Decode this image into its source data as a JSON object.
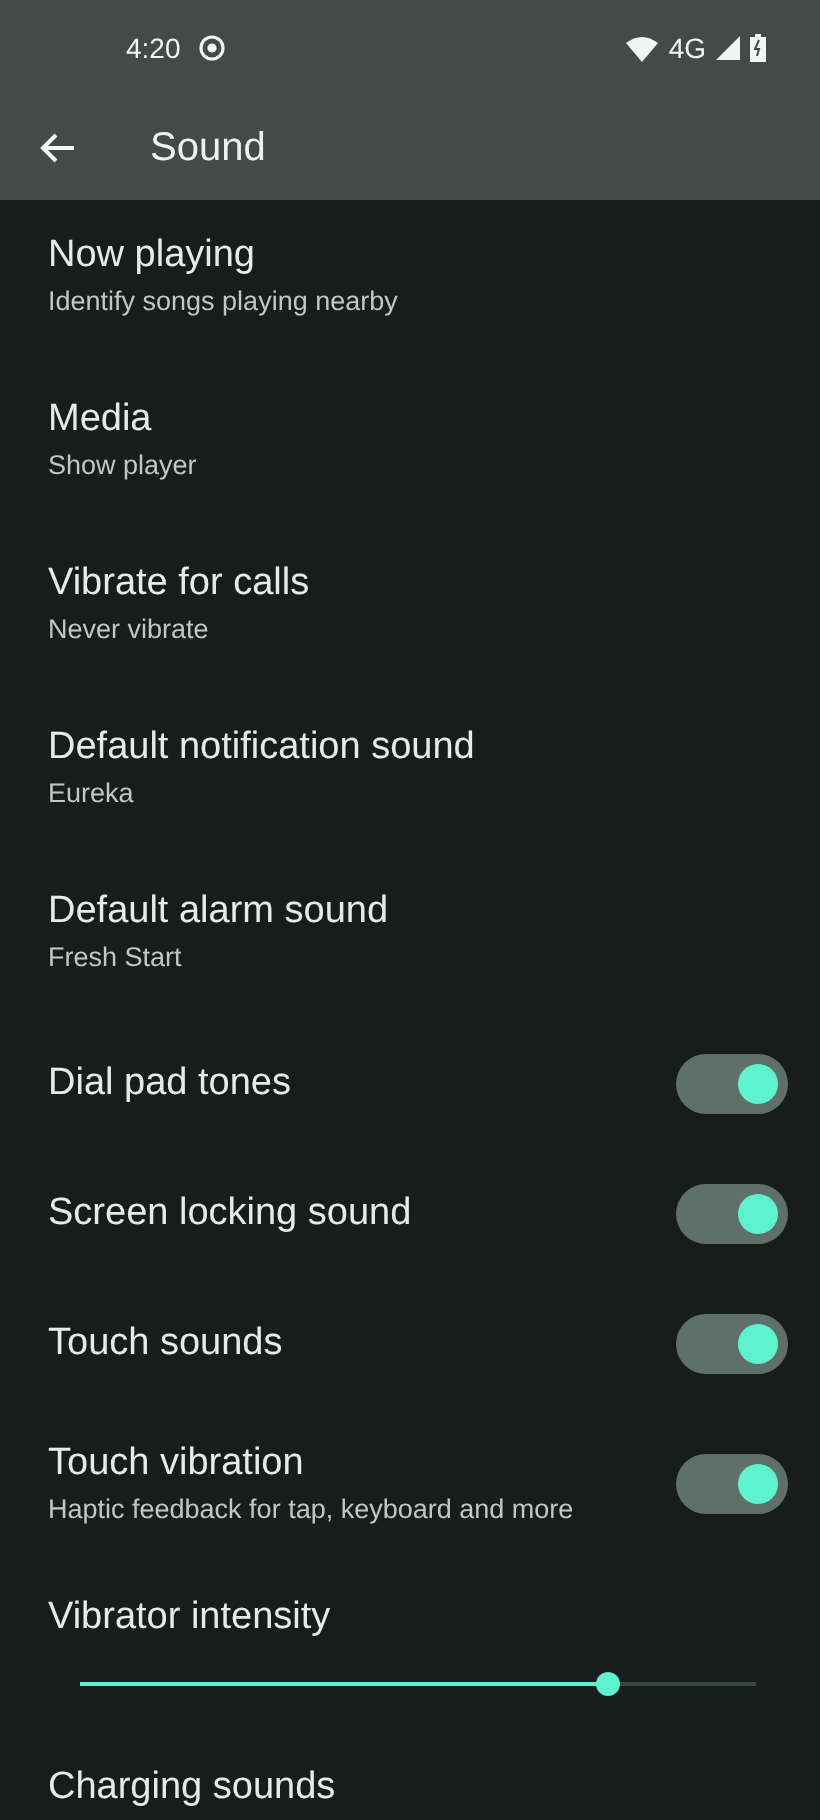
{
  "status_bar": {
    "time": "4:20",
    "network": "4G"
  },
  "app_bar": {
    "title": "Sound"
  },
  "items": [
    {
      "kind": "link",
      "title": "Now playing",
      "subtitle": "Identify songs playing nearby"
    },
    {
      "kind": "link",
      "title": "Media",
      "subtitle": "Show player"
    },
    {
      "kind": "link",
      "title": "Vibrate for calls",
      "subtitle": "Never vibrate"
    },
    {
      "kind": "link",
      "title": "Default notification sound",
      "subtitle": "Eureka"
    },
    {
      "kind": "link",
      "title": "Default alarm sound",
      "subtitle": "Fresh Start"
    },
    {
      "kind": "toggle",
      "title": "Dial pad tones",
      "on": true
    },
    {
      "kind": "toggle",
      "title": "Screen locking sound",
      "on": true
    },
    {
      "kind": "toggle",
      "title": "Touch sounds",
      "on": true
    },
    {
      "kind": "toggle",
      "title": "Touch vibration",
      "subtitle": "Haptic feedback for tap, keyboard and more",
      "on": true
    },
    {
      "kind": "slider",
      "title": "Vibrator intensity",
      "level": 0.78
    },
    {
      "kind": "link",
      "title": "Charging sounds"
    }
  ]
}
